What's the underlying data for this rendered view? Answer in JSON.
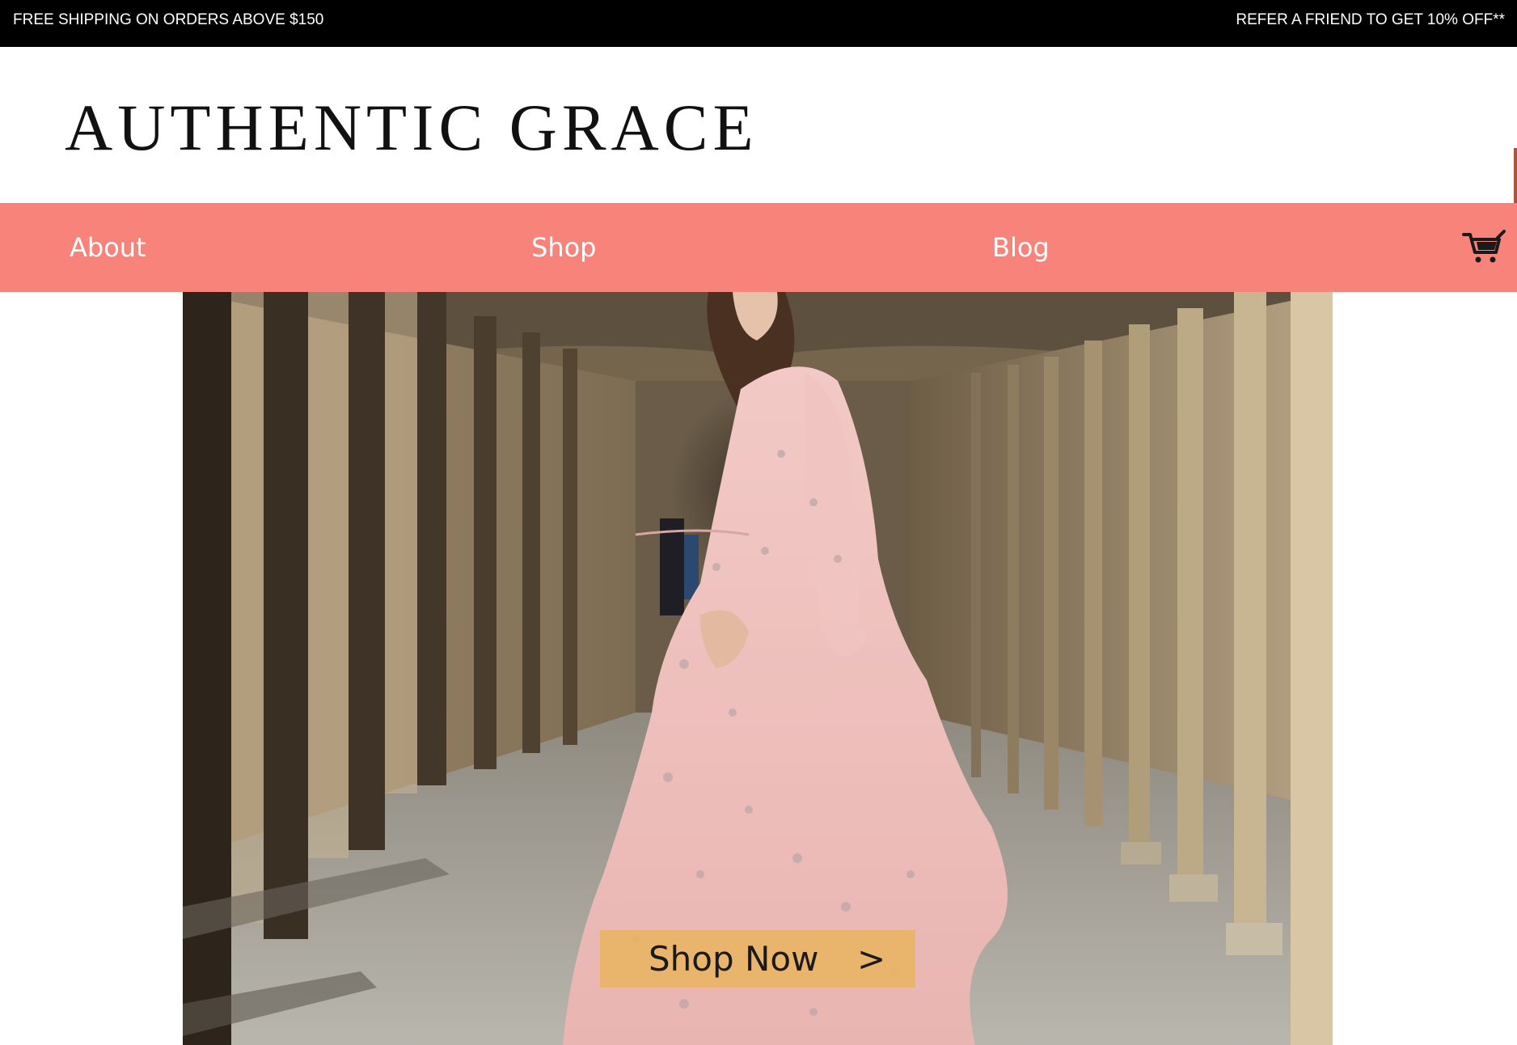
{
  "announcement": {
    "left_text": "FREE SHIPPING ON ORDERS ABOVE $150",
    "right_text": "REFER A FRIEND TO GET 10% OFF**"
  },
  "logo": {
    "word1": "AUTHENTIC",
    "word2": "GRACE",
    "underline_color": "#e8b462"
  },
  "nav": {
    "background_color": "#f7837b",
    "items": [
      {
        "label": "About"
      },
      {
        "label": "Shop"
      },
      {
        "label": "Blog"
      }
    ],
    "cart_icon": "shopping-cart-icon"
  },
  "hero": {
    "image_description_icon": "hero-photo",
    "cta": {
      "label": "Shop Now",
      "arrow": ">"
    }
  }
}
